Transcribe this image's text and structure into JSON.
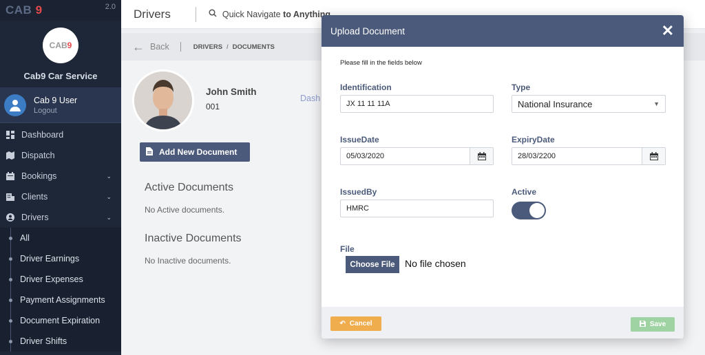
{
  "app": {
    "brand_prefix": "CAB ",
    "brand_num": "9",
    "version": "2.0"
  },
  "org": {
    "logo_prefix": "CAB",
    "logo_num": "9",
    "name": "Cab9 Car Service"
  },
  "user": {
    "name": "Cab 9 User",
    "logout": "Logout"
  },
  "nav": {
    "items": [
      {
        "label": "Dashboard",
        "icon": "dashboard-icon"
      },
      {
        "label": "Dispatch",
        "icon": "map-icon"
      },
      {
        "label": "Bookings",
        "icon": "calendar-icon",
        "expandable": true
      },
      {
        "label": "Clients",
        "icon": "building-icon",
        "expandable": true
      },
      {
        "label": "Drivers",
        "icon": "user-circle-icon",
        "expandable": true
      }
    ],
    "driver_subitems": [
      "All",
      "Driver Earnings",
      "Driver Expenses",
      "Payment Assignments",
      "Document Expiration",
      "Driver Shifts"
    ]
  },
  "topbar": {
    "title": "Drivers",
    "quick_nav_prefix": "Quick Navigate ",
    "quick_nav_bold": "to Anything"
  },
  "breadcrumb": {
    "back": "Back",
    "crumb1": "DRIVERS",
    "crumb2": "DOCUMENTS"
  },
  "driver": {
    "name": "John Smith",
    "id": "001",
    "tab": "Dash"
  },
  "documents": {
    "add_button": "Add New Document",
    "active_title": "Active Documents",
    "active_empty": "No Active documents.",
    "inactive_title": "Inactive Documents",
    "inactive_empty": "No Inactive documents."
  },
  "modal": {
    "title": "Upload Document",
    "instructions": "Please fill in the fields below",
    "fields": {
      "identification": {
        "label": "Identification",
        "value": "JX 11 11 11A"
      },
      "type": {
        "label": "Type",
        "value": "National Insurance"
      },
      "issue_date": {
        "label": "IssueDate",
        "value": "05/03/2020"
      },
      "expiry_date": {
        "label": "ExpiryDate",
        "value": "28/03/2200"
      },
      "issued_by": {
        "label": "IssuedBy",
        "value": "HMRC"
      },
      "active": {
        "label": "Active",
        "checked": true
      },
      "file": {
        "label": "File",
        "button": "Choose File",
        "status": "No file chosen"
      }
    },
    "cancel": "Cancel",
    "save": "Save"
  },
  "colors": {
    "primary": "#4b5a7a",
    "sidebar": "#1e2738",
    "cancel": "#f0ad4e",
    "save": "#9fd3a3",
    "accent_red": "#e34a4a"
  }
}
